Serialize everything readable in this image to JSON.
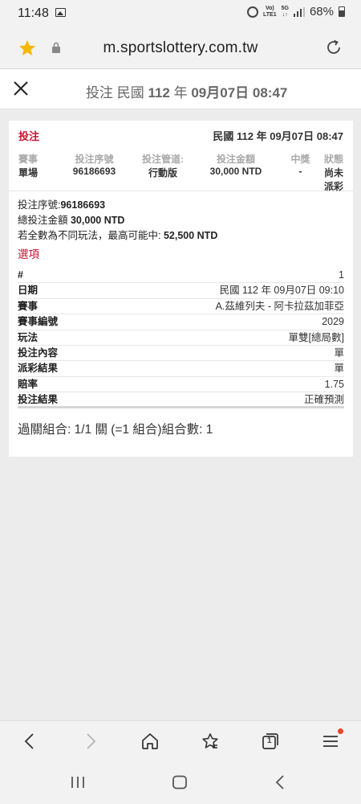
{
  "status_bar": {
    "time": "11:48",
    "network_top": "Vo)",
    "network_bottom": "LTE1",
    "network_5g": "5G",
    "battery": "68%"
  },
  "browser": {
    "url": "m.sportslottery.com.tw"
  },
  "header": {
    "title_prefix": "投注 民國 ",
    "title_year": "112",
    "title_mid": " 年 ",
    "title_date": "09月07日 08:47"
  },
  "card": {
    "bet_label": "投注",
    "bet_datetime": "民國 112 年 09月07日 08:47",
    "summary_headers": [
      "賽事",
      "投注序號",
      "投注管道:",
      "投注金額",
      "中獎",
      "狀態"
    ],
    "summary_values": [
      "單場",
      "96186693",
      "行動版",
      "30,000 NTD",
      "-",
      "尚未派彩"
    ],
    "serial_label": "投注序號:",
    "serial_value": "96186693",
    "total_label": "總投注金額 ",
    "total_value": "30,000 NTD",
    "maxwin_label": "若全數為不同玩法，最高可能中: ",
    "maxwin_value": "52,500 NTD",
    "options_label": "選項",
    "detail_rows": [
      {
        "key": "#",
        "value": "1"
      },
      {
        "key": "日期",
        "value": "民國 112 年 09月07日 09:10"
      },
      {
        "key": "賽事",
        "value": "A.茲維列夫 - 阿卡拉茲加菲亞"
      },
      {
        "key": "賽事編號",
        "value": "2029"
      },
      {
        "key": "玩法",
        "value": "單雙[總局數]"
      },
      {
        "key": "投注內容",
        "value": "單"
      },
      {
        "key": "派彩結果",
        "value": "單"
      },
      {
        "key": "賠率",
        "value": "1.75"
      },
      {
        "key": "投注結果",
        "value": "正確預測"
      }
    ],
    "parlay_text": "過關組合: 1/1 關 (=1 組合)組合數: 1"
  },
  "toolbar": {
    "tab_count": "1"
  },
  "colors": {
    "accent_red": "#c8102e",
    "star_yellow": "#f5b800",
    "menu_dot": "#e8452c"
  }
}
